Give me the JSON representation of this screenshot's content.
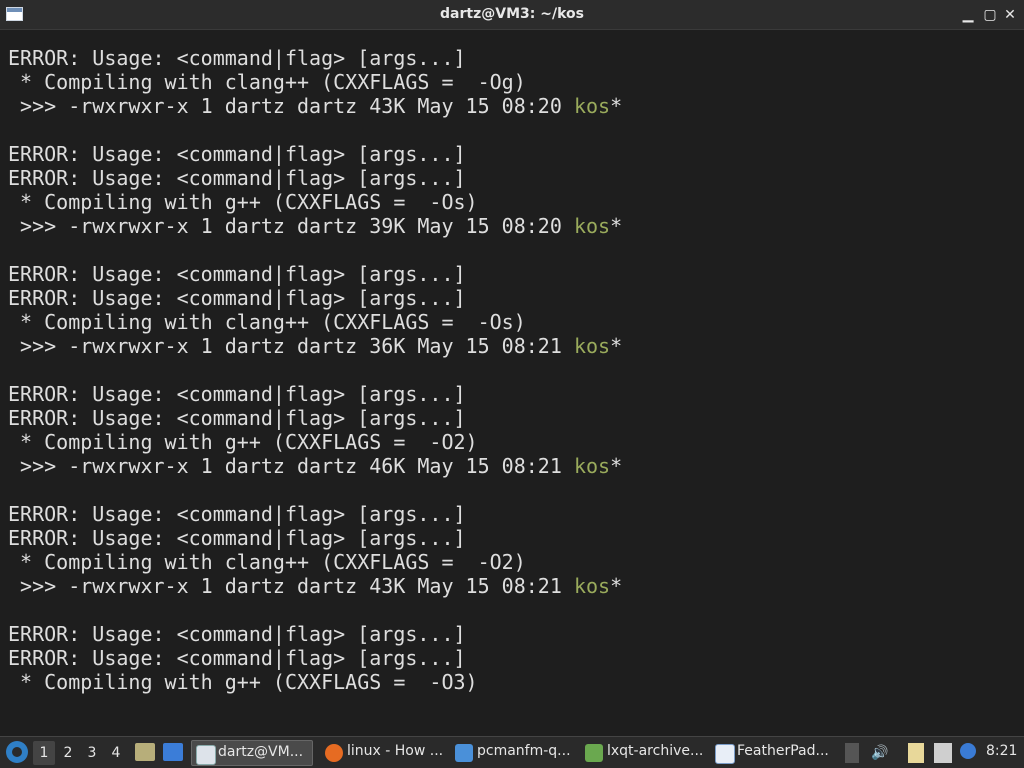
{
  "window": {
    "title": "dartz@VM3: ~/kos",
    "minimize_glyph": "▁",
    "maximize_glyph": "▢",
    "close_glyph": "✕"
  },
  "terminal": {
    "lines": [
      {
        "text": "ERROR: Usage: <command|flag> [args...]",
        "highlight": ""
      },
      {
        "text": " * Compiling with clang++ (CXXFLAGS =  -Og)",
        "highlight": ""
      },
      {
        "text": " >>> -rwxrwxr-x 1 dartz dartz 43K May 15 08:20 ",
        "highlight": "kos",
        "suffix": "*"
      },
      {
        "text": "",
        "highlight": ""
      },
      {
        "text": "ERROR: Usage: <command|flag> [args...]",
        "highlight": ""
      },
      {
        "text": "ERROR: Usage: <command|flag> [args...]",
        "highlight": ""
      },
      {
        "text": " * Compiling with g++ (CXXFLAGS =  -Os)",
        "highlight": ""
      },
      {
        "text": " >>> -rwxrwxr-x 1 dartz dartz 39K May 15 08:20 ",
        "highlight": "kos",
        "suffix": "*"
      },
      {
        "text": "",
        "highlight": ""
      },
      {
        "text": "ERROR: Usage: <command|flag> [args...]",
        "highlight": ""
      },
      {
        "text": "ERROR: Usage: <command|flag> [args...]",
        "highlight": ""
      },
      {
        "text": " * Compiling with clang++ (CXXFLAGS =  -Os)",
        "highlight": ""
      },
      {
        "text": " >>> -rwxrwxr-x 1 dartz dartz 36K May 15 08:21 ",
        "highlight": "kos",
        "suffix": "*"
      },
      {
        "text": "",
        "highlight": ""
      },
      {
        "text": "ERROR: Usage: <command|flag> [args...]",
        "highlight": ""
      },
      {
        "text": "ERROR: Usage: <command|flag> [args...]",
        "highlight": ""
      },
      {
        "text": " * Compiling with g++ (CXXFLAGS =  -O2)",
        "highlight": ""
      },
      {
        "text": " >>> -rwxrwxr-x 1 dartz dartz 46K May 15 08:21 ",
        "highlight": "kos",
        "suffix": "*"
      },
      {
        "text": "",
        "highlight": ""
      },
      {
        "text": "ERROR: Usage: <command|flag> [args...]",
        "highlight": ""
      },
      {
        "text": "ERROR: Usage: <command|flag> [args...]",
        "highlight": ""
      },
      {
        "text": " * Compiling with clang++ (CXXFLAGS =  -O2)",
        "highlight": ""
      },
      {
        "text": " >>> -rwxrwxr-x 1 dartz dartz 43K May 15 08:21 ",
        "highlight": "kos",
        "suffix": "*"
      },
      {
        "text": "",
        "highlight": ""
      },
      {
        "text": "ERROR: Usage: <command|flag> [args...]",
        "highlight": ""
      },
      {
        "text": "ERROR: Usage: <command|flag> [args...]",
        "highlight": ""
      },
      {
        "text": " * Compiling with g++ (CXXFLAGS =  -O3)",
        "highlight": ""
      },
      {
        "text": "",
        "highlight": ""
      }
    ],
    "cursor": "_",
    "colors": {
      "text": "#dedede",
      "highlight": "#9aab5c",
      "background": "#1e1e1e"
    }
  },
  "taskbar": {
    "desktops": [
      "1",
      "2",
      "3",
      "4"
    ],
    "active_desktop": "1",
    "tasks": [
      {
        "label": "dartz@VM...",
        "icon": "terminal-icon",
        "active": true
      },
      {
        "label": "linux - How ...",
        "icon": "firefox-icon",
        "active": false
      },
      {
        "label": "pcmanfm-q...",
        "icon": "folder-icon",
        "active": false
      },
      {
        "label": "lxqt-archive...",
        "icon": "archive-icon",
        "active": false
      },
      {
        "label": "FeatherPad...",
        "icon": "featherpad-icon",
        "active": false
      }
    ],
    "clock": "8:21"
  }
}
